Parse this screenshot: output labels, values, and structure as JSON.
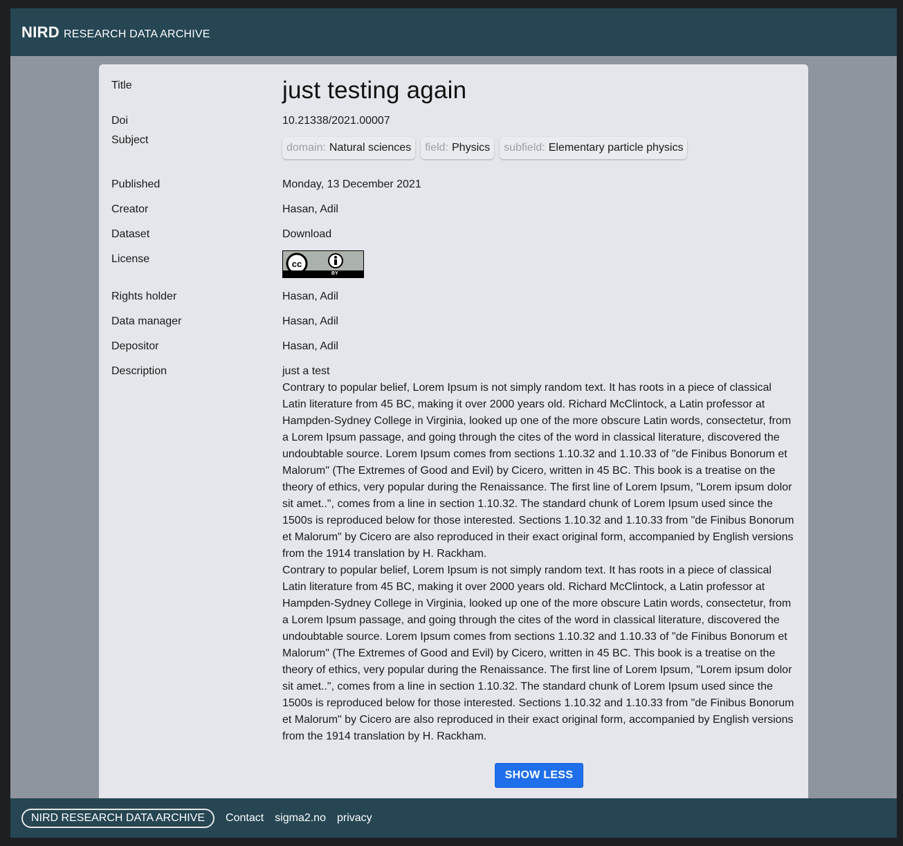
{
  "header": {
    "brand_bold": "NIRD",
    "brand_rest": "RESEARCH DATA ARCHIVE"
  },
  "record": {
    "title_label": "Title",
    "title": "just testing again",
    "doi_label": "Doi",
    "doi": "10.21338/2021.00007",
    "subject_label": "Subject",
    "subjects": [
      {
        "key": "domain:",
        "value": "Natural sciences"
      },
      {
        "key": "field:",
        "value": "Physics"
      },
      {
        "key": "subfield:",
        "value": "Elementary particle physics"
      }
    ],
    "published_label": "Published",
    "published": "Monday, 13 December 2021",
    "creator_label": "Creator",
    "creator": "Hasan, Adil",
    "dataset_label": "Dataset",
    "dataset": "Download",
    "license_label": "License",
    "license_badge": "BY",
    "rights_holder_label": "Rights holder",
    "rights_holder": "Hasan, Adil",
    "data_manager_label": "Data manager",
    "data_manager": "Hasan, Adil",
    "depositor_label": "Depositor",
    "depositor": "Hasan, Adil",
    "description_label": "Description",
    "description_lines": [
      "just a test",
      "Contrary to popular belief, Lorem Ipsum is not simply random text. It has roots in a piece of classical Latin literature from 45 BC, making it over 2000 years old. Richard McClintock, a Latin professor at Hampden-Sydney College in Virginia, looked up one of the more obscure Latin words, consectetur, from a Lorem Ipsum passage, and going through the cites of the word in classical literature, discovered the undoubtable source. Lorem Ipsum comes from sections 1.10.32 and 1.10.33 of \"de Finibus Bonorum et Malorum\" (The Extremes of Good and Evil) by Cicero, written in 45 BC. This book is a treatise on the theory of ethics, very popular during the Renaissance. The first line of Lorem Ipsum, \"Lorem ipsum dolor sit amet..\", comes from a line in section 1.10.32. The standard chunk of Lorem Ipsum used since the 1500s is reproduced below for those interested. Sections 1.10.32 and 1.10.33 from \"de Finibus Bonorum et Malorum\" by Cicero are also reproduced in their exact original form, accompanied by English versions from the 1914 translation by H. Rackham.",
      "Contrary to popular belief, Lorem Ipsum is not simply random text. It has roots in a piece of classical Latin literature from 45 BC, making it over 2000 years old. Richard McClintock, a Latin professor at Hampden-Sydney College in Virginia, looked up one of the more obscure Latin words, consectetur, from a Lorem Ipsum passage, and going through the cites of the word in classical literature, discovered the undoubtable source. Lorem Ipsum comes from sections 1.10.32 and 1.10.33 of \"de Finibus Bonorum et Malorum\" (The Extremes of Good and Evil) by Cicero, written in 45 BC. This book is a treatise on the theory of ethics, very popular during the Renaissance. The first line of Lorem Ipsum, \"Lorem ipsum dolor sit amet..\", comes from a line in section 1.10.32. The standard chunk of Lorem Ipsum used since the 1500s is reproduced below for those interested. Sections 1.10.32 and 1.10.33 from \"de Finibus Bonorum et Malorum\" by Cicero are also reproduced in their exact original form, accompanied by English versions from the 1914 translation by H. Rackham."
    ],
    "show_less_label": "SHOW LESS"
  },
  "footer": {
    "brand": "NIRD RESEARCH DATA ARCHIVE",
    "links": [
      "Contact",
      "sigma2.no",
      "privacy"
    ]
  },
  "colors": {
    "header_bg": "#264653",
    "page_bg": "#8f959e",
    "card_bg": "#e4e6eb",
    "button": "#1f6feb"
  }
}
